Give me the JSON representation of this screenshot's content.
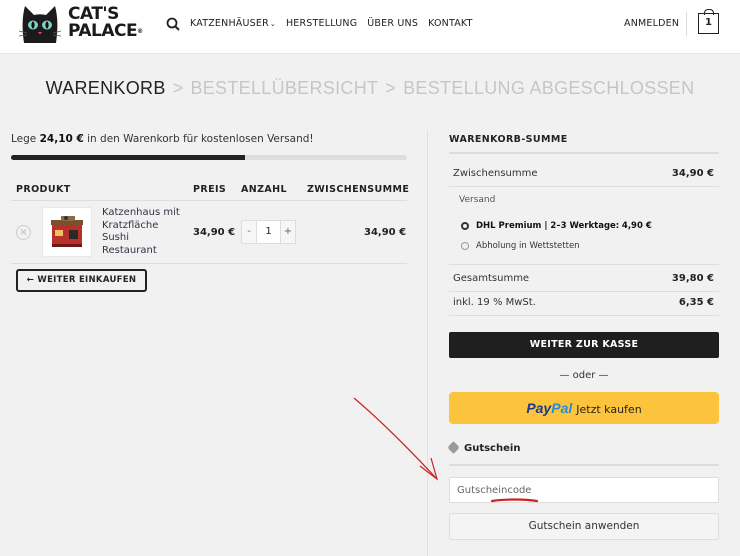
{
  "brand": {
    "line1": "CAT'S",
    "line2": "PALACE",
    "mark": "®"
  },
  "nav": {
    "search_icon": "search-icon",
    "items": [
      "KATZENHÄUSER",
      "HERSTELLUNG",
      "ÜBER UNS",
      "KONTAKT"
    ],
    "login": "ANMELDEN",
    "cart_count": "1"
  },
  "breadcrumb": {
    "step1": "WARENKORB",
    "step2": "BESTELLÜBERSICHT",
    "step3": "BESTELLUNG ABGESCHLOSSEN",
    "separator": ">"
  },
  "shipping_notice": {
    "prefix": "Lege",
    "amount": "24,10 €",
    "suffix": "in den Warenkorb für kostenlosen Versand!",
    "progress_percent": 59
  },
  "cart_table": {
    "headers": {
      "product": "PRODUKT",
      "price": "PREIS",
      "quantity": "ANZAHL",
      "subtotal": "ZWISCHENSUMME"
    },
    "items": [
      {
        "name": "Katzenhaus mit Kratzfläche Sushi Restaurant",
        "price": "34,90 €",
        "quantity": "1",
        "subtotal": "34,90 €",
        "minus": "-",
        "plus": "+",
        "remove": "×"
      }
    ],
    "continue_label": "← WEITER EINKAUFEN"
  },
  "totals": {
    "title": "WARENKORB-SUMME",
    "subtotal_label": "Zwischensumme",
    "subtotal_value": "34,90 €",
    "shipping_label": "Versand",
    "shipping_options": [
      {
        "label": "DHL Premium | 2–3 Werktage:",
        "price": "4,90 €",
        "selected": true
      },
      {
        "label": "Abholung in Wettstetten",
        "price": "",
        "selected": false
      }
    ],
    "total_label": "Gesamtsumme",
    "total_value": "39,80 €",
    "tax_label": "inkl. 19 % MwSt.",
    "tax_value": "6,35 €",
    "checkout_label": "WEITER ZUR KASSE",
    "or_label": "— oder —",
    "paypal_a": "Pay",
    "paypal_b": "Pal",
    "paypal_now": "Jetzt kaufen"
  },
  "coupon": {
    "title": "Gutschein",
    "placeholder": "Gutscheincode",
    "apply_label": "Gutschein anwenden"
  },
  "colors": {
    "accent_dark": "#1f1f1f",
    "paypal_yellow": "#fcc43c",
    "annotation_red": "#cc2222"
  }
}
